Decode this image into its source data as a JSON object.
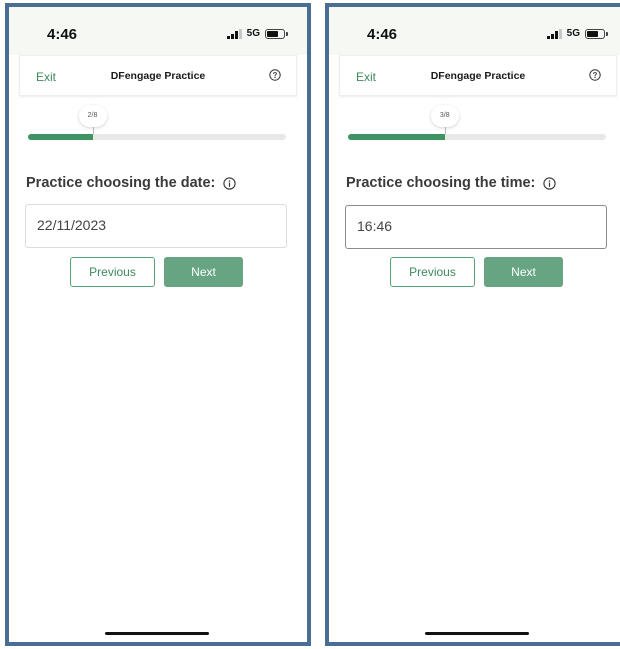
{
  "colors": {
    "frame": "#4a6d94",
    "accent": "#3d9462",
    "accent_text": "#3d8a5c",
    "next_button": "#67a582"
  },
  "screens": [
    {
      "status": {
        "time": "4:46",
        "network": "5G"
      },
      "header": {
        "exit_label": "Exit",
        "title": "DFengage Practice",
        "help_icon": "help-circle-icon"
      },
      "progress": {
        "label": "2/8",
        "current": 2,
        "total": 8
      },
      "question": {
        "text": "Practice choosing the date:",
        "info_icon": "info-icon"
      },
      "answer": {
        "value": "22/11/2023"
      },
      "buttons": {
        "previous": "Previous",
        "next": "Next"
      }
    },
    {
      "status": {
        "time": "4:46",
        "network": "5G"
      },
      "header": {
        "exit_label": "Exit",
        "title": "DFengage Practice",
        "help_icon": "help-circle-icon"
      },
      "progress": {
        "label": "3/8",
        "current": 3,
        "total": 8
      },
      "question": {
        "text": "Practice choosing the time:",
        "info_icon": "info-icon"
      },
      "answer": {
        "value": "16:46"
      },
      "buttons": {
        "previous": "Previous",
        "next": "Next"
      }
    }
  ]
}
